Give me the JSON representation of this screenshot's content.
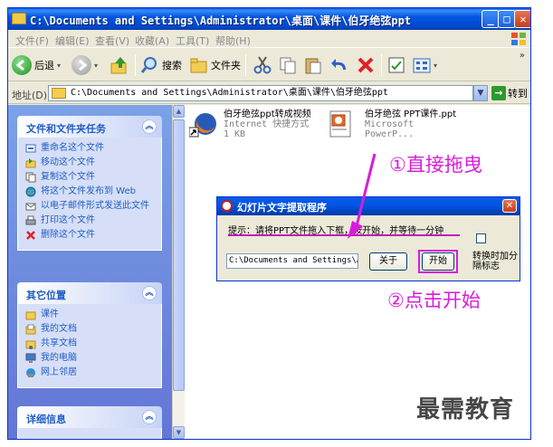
{
  "window": {
    "title": "C:\\Documents and Settings\\Administrator\\桌面\\课件\\伯牙绝弦ppt"
  },
  "menu": [
    "文件(F)",
    "编辑(E)",
    "查看(V)",
    "收藏(A)",
    "工具(T)",
    "帮助(H)"
  ],
  "toolbar": {
    "back": "后退",
    "search": "搜索",
    "folders": "文件夹"
  },
  "address": {
    "label": "地址(D)",
    "value": "C:\\Documents and Settings\\Administrator\\桌面\\课件\\伯牙绝弦ppt",
    "go": "转到"
  },
  "tasks": {
    "header": "文件和文件夹任务",
    "items": [
      "重命名这个文件",
      "移动这个文件",
      "复制这个文件",
      "将这个文件发布到 Web",
      "以电子邮件形式发送此文件",
      "打印这个文件",
      "删除这个文件"
    ]
  },
  "places": {
    "header": "其它位置",
    "items": [
      "课件",
      "我的文档",
      "共享文档",
      "我的电脑",
      "网上邻居"
    ]
  },
  "details": {
    "header": "详细信息"
  },
  "files": [
    {
      "name": "伯牙绝弦ppt转成视频",
      "type": "Internet 快捷方式",
      "size": "1 KB"
    },
    {
      "name": "伯牙绝弦 PPT课件.ppt",
      "type": "Microsoft PowerP..."
    }
  ],
  "dialog": {
    "title": "幻灯片文字提取程序",
    "hint": "提示：请将PPT文件拖入下框，按开始，并等待一分钟",
    "path": "C:\\Documents and Settings\\A",
    "about": "关于",
    "start": "开始",
    "option": "转换时加分隔标志"
  },
  "annotations": {
    "step1": "①直接拖曳",
    "step2": "②点击开始"
  },
  "watermark": "最需教育",
  "colors": {
    "annotation": "#d91bd9",
    "titlebar": "#0054e3",
    "taskpane": "#7ba2e7"
  }
}
